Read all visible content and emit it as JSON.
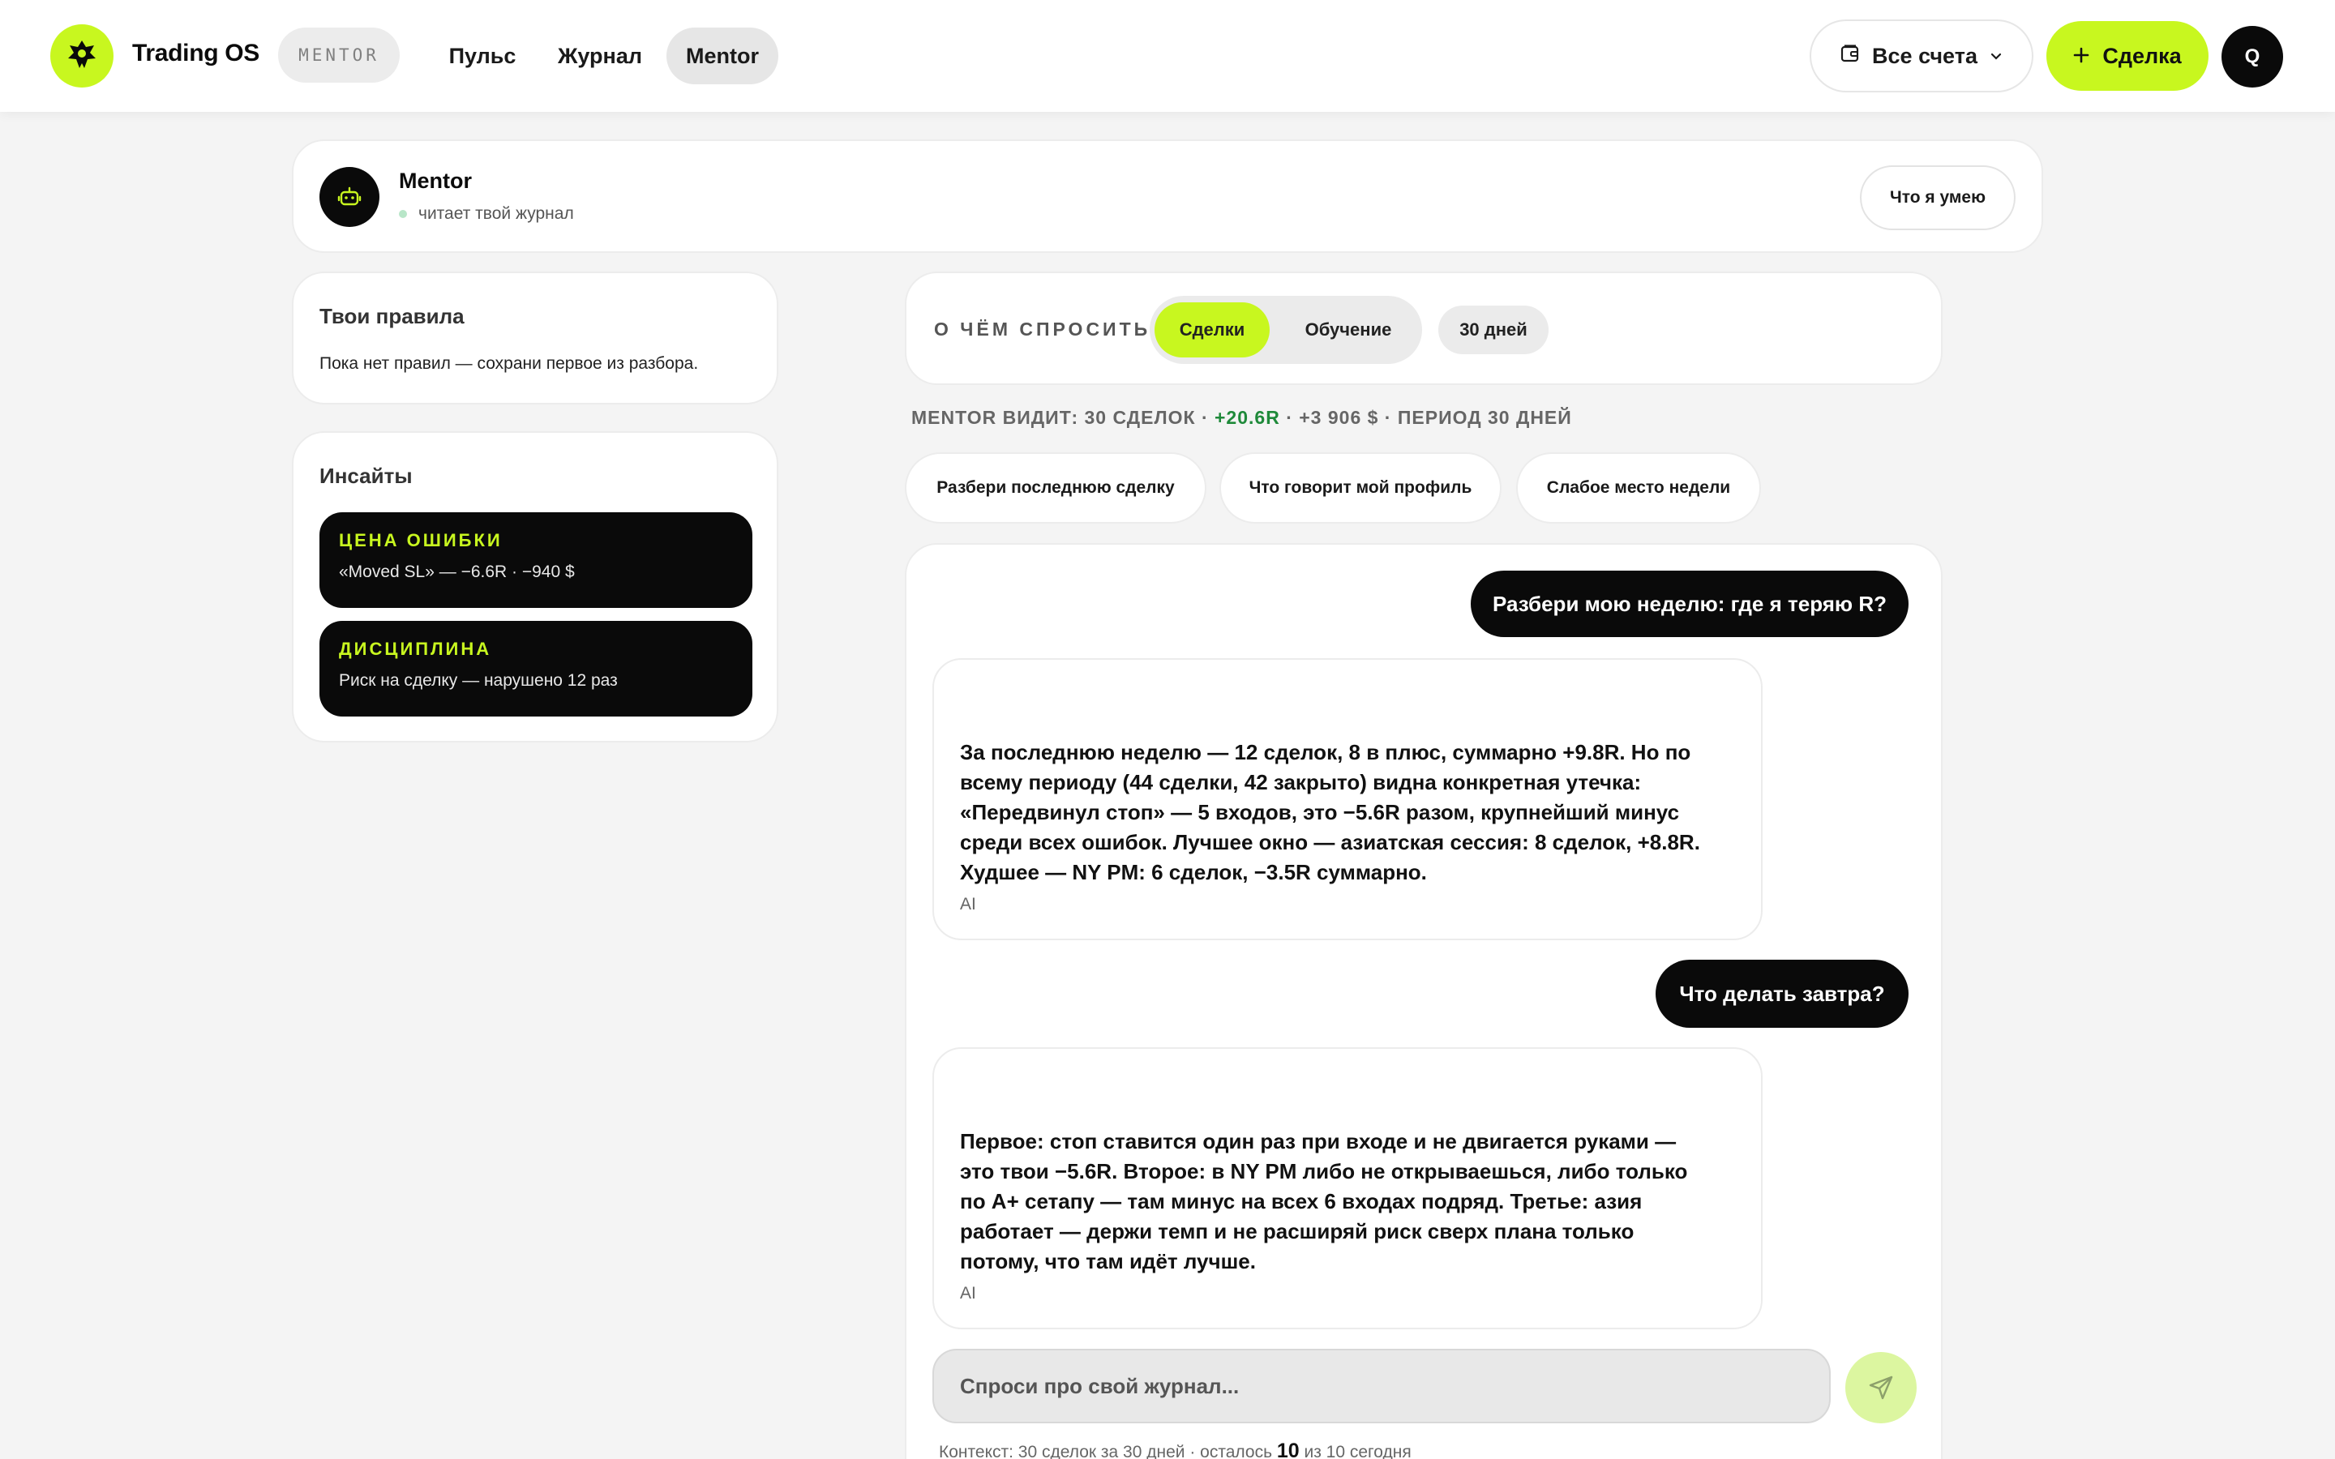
{
  "header": {
    "brand": "Trading OS",
    "mode_badge": "MENTOR",
    "nav": [
      "Пульс",
      "Журнал",
      "Mentor"
    ],
    "accounts_label": "Все счета",
    "new_deal_label": "Сделка",
    "avatar_letter": "Q"
  },
  "mentor": {
    "title": "Mentor",
    "status": "читает твой журнал",
    "capabilities_button": "Что я умею"
  },
  "rules": {
    "heading": "Твои правила",
    "empty": "Пока нет правил — сохрани первое из разбора."
  },
  "insights": {
    "heading": "Инсайты",
    "items": [
      {
        "tag": "ЦЕНА ОШИБКИ",
        "text": "«Moved SL» — −6.6R · −940 $"
      },
      {
        "tag": "ДИСЦИПЛИНА",
        "text": "Риск на сделку — нарушено 12 раз"
      }
    ]
  },
  "ask": {
    "label": "О ЧЁМ СПРОСИТЬ",
    "segments": [
      "Сделки",
      "Обучение"
    ],
    "active_segment": "Сделки",
    "period": "30 дней"
  },
  "context_meta": {
    "prefix": "MENTOR ВИДИТ: 30 СДЕЛОК · ",
    "r_value": "+20.6R",
    "suffix": " · +3 906 $ · ПЕРИОД 30 ДНЕЙ"
  },
  "prompt_chips": [
    "Разбери последнюю сделку",
    "Что говорит мой профиль",
    "Слабое место недели"
  ],
  "chat": {
    "messages": [
      {
        "role": "user",
        "text": "Разбери мою неделю: где я теряю R?"
      },
      {
        "role": "ai",
        "text": "За последнюю неделю — 12 сделок, 8 в плюс, суммарно +9.8R. Но по всему периоду (44 сделки, 42 закрыто) видна конкретная утечка: «Передвинул стоп» — 5 входов, это −5.6R разом, крупнейший минус среди всех ошибок. Лучшее окно — азиатская сессия: 8 сделок, +8.8R. Худшее — NY PM: 6 сделок, −3.5R суммарно.",
        "label": "AI"
      },
      {
        "role": "user",
        "text": "Что делать завтра?"
      },
      {
        "role": "ai",
        "text": "Первое: стоп ставится один раз при входе и не двигается руками — это твои −5.6R. Второе: в NY PM либо не открываешься, либо только по A+ сетапу — там минус на всех 6 входах подряд. Третье: азия работает — держи темп и не расширяй риск сверх плана только потому, что там идёт лучше.",
        "label": "AI"
      }
    ],
    "input_placeholder": "Спроси про свой журнал...",
    "context_prefix": "Контекст: 30 сделок за 30 дней · осталось ",
    "remaining": "10",
    "context_suffix": " из 10 сегодня"
  },
  "colors": {
    "accent": "#c8f71f",
    "ink": "#0a0a0a",
    "background": "#f4f4f4",
    "positive": "#1f8a3a"
  },
  "icons": {
    "logo": "logo-icon",
    "wallet": "wallet-icon",
    "chevron": "chevron-down-icon",
    "plus": "plus-icon",
    "bot": "bot-icon",
    "send": "send-icon"
  }
}
